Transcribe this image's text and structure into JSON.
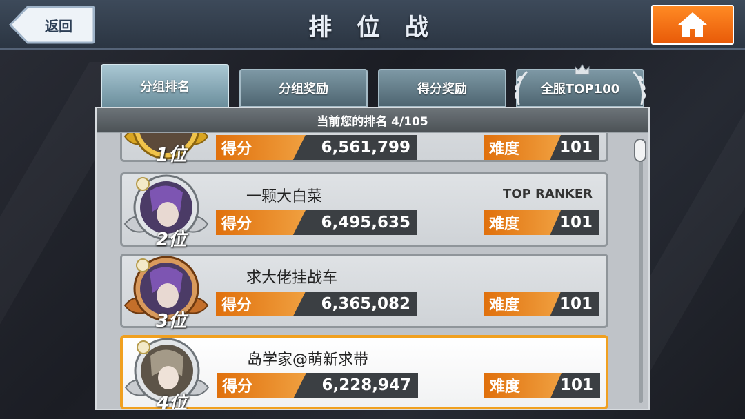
{
  "header": {
    "back_label": "返回",
    "title": "排 位 战",
    "home_icon": "home-icon"
  },
  "tabs": [
    {
      "label": "分组排名",
      "active": true
    },
    {
      "label": "分组奖励",
      "active": false
    },
    {
      "label": "得分奖励",
      "active": false
    },
    {
      "label": "全服TOP100",
      "active": false
    }
  ],
  "rank_summary": "当前您的排名 4/105",
  "entries": [
    {
      "rank": "1位",
      "medal": "gold",
      "name": "",
      "tag": "",
      "score_label": "得分",
      "score": "6,561,799",
      "difficulty_label": "难度",
      "difficulty": "101",
      "is_self": false
    },
    {
      "rank": "2位",
      "medal": "silver",
      "name": "一颗大白菜",
      "tag": "TOP RANKER",
      "score_label": "得分",
      "score": "6,495,635",
      "difficulty_label": "难度",
      "difficulty": "101",
      "is_self": false
    },
    {
      "rank": "3位",
      "medal": "bronze",
      "name": "求大佬挂战车",
      "tag": "",
      "score_label": "得分",
      "score": "6,365,082",
      "difficulty_label": "难度",
      "difficulty": "101",
      "is_self": false
    },
    {
      "rank": "4位",
      "medal": "silver",
      "name": "岛学家@萌新求带",
      "tag": "",
      "score_label": "得分",
      "score": "6,228,947",
      "difficulty_label": "难度",
      "difficulty": "101",
      "is_self": true
    }
  ],
  "colors": {
    "accent_orange": "#e85a08",
    "highlight_border": "#f0a020",
    "gold": "#d9a521",
    "silver": "#c9ccd0",
    "bronze": "#c46f2a"
  }
}
